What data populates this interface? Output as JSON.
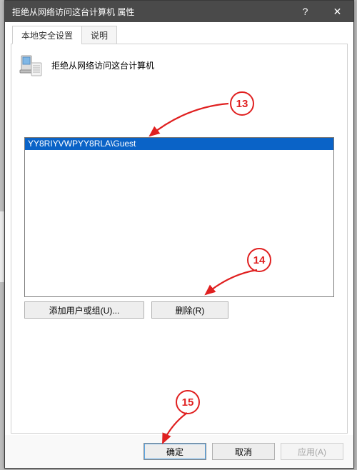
{
  "window": {
    "title": "拒绝从网络访问这台计算机 属性",
    "help_glyph": "?",
    "close_glyph": "✕"
  },
  "tabs": {
    "items": [
      {
        "label": "本地安全设置",
        "active": true
      },
      {
        "label": "说明",
        "active": false
      }
    ]
  },
  "policy": {
    "title": "拒绝从网络访问这台计算机"
  },
  "list": {
    "items": [
      {
        "text": "YY8RIYVWPYY8RLA\\Guest",
        "selected": true
      }
    ]
  },
  "buttons": {
    "add": "添加用户或组(U)...",
    "remove": "删除(R)"
  },
  "footer": {
    "ok": "确定",
    "cancel": "取消",
    "apply": "应用(A)"
  },
  "callouts": {
    "c13": "13",
    "c14": "14",
    "c15": "15"
  }
}
